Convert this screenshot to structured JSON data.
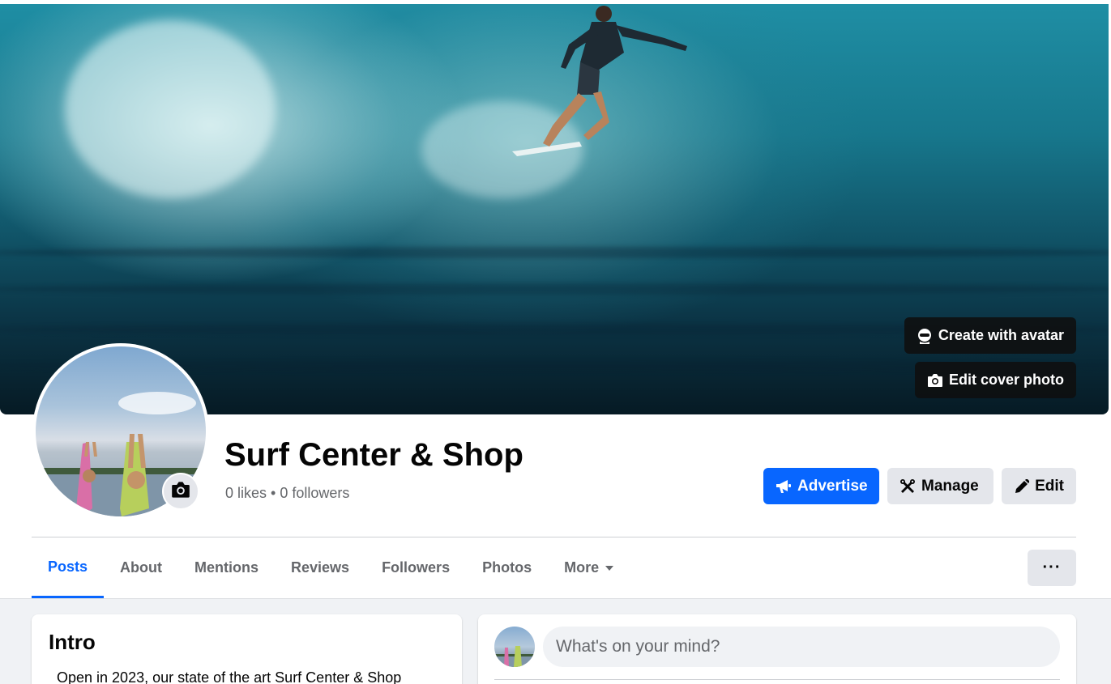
{
  "cover": {
    "create_avatar_label": "Create with avatar",
    "edit_cover_label": "Edit cover photo"
  },
  "page": {
    "name": "Surf Center & Shop",
    "stats": "0 likes • 0 followers"
  },
  "actions": {
    "advertise_label": "Advertise",
    "manage_label": "Manage",
    "edit_label": "Edit"
  },
  "tabs": [
    {
      "label": "Posts",
      "active": true
    },
    {
      "label": "About"
    },
    {
      "label": "Mentions"
    },
    {
      "label": "Reviews"
    },
    {
      "label": "Followers"
    },
    {
      "label": "Photos"
    },
    {
      "label": "More"
    }
  ],
  "more_options_label": "···",
  "intro": {
    "title": "Intro",
    "text": "Open in 2023, our state of the art Surf Center & Shop"
  },
  "composer": {
    "placeholder": "What's on your mind?"
  },
  "colors": {
    "accent": "#0866ff",
    "button_gray": "#e4e6eb",
    "text_secondary": "#65676b",
    "page_bg": "#f0f2f5"
  },
  "icons": {
    "create_avatar": "avatar-icon",
    "edit_cover": "camera-icon",
    "avatar_camera": "camera-icon",
    "advertise": "megaphone-icon",
    "manage": "tools-icon",
    "edit": "pencil-icon",
    "more_tab": "caret-down-icon",
    "more_options": "more-options-icon"
  }
}
